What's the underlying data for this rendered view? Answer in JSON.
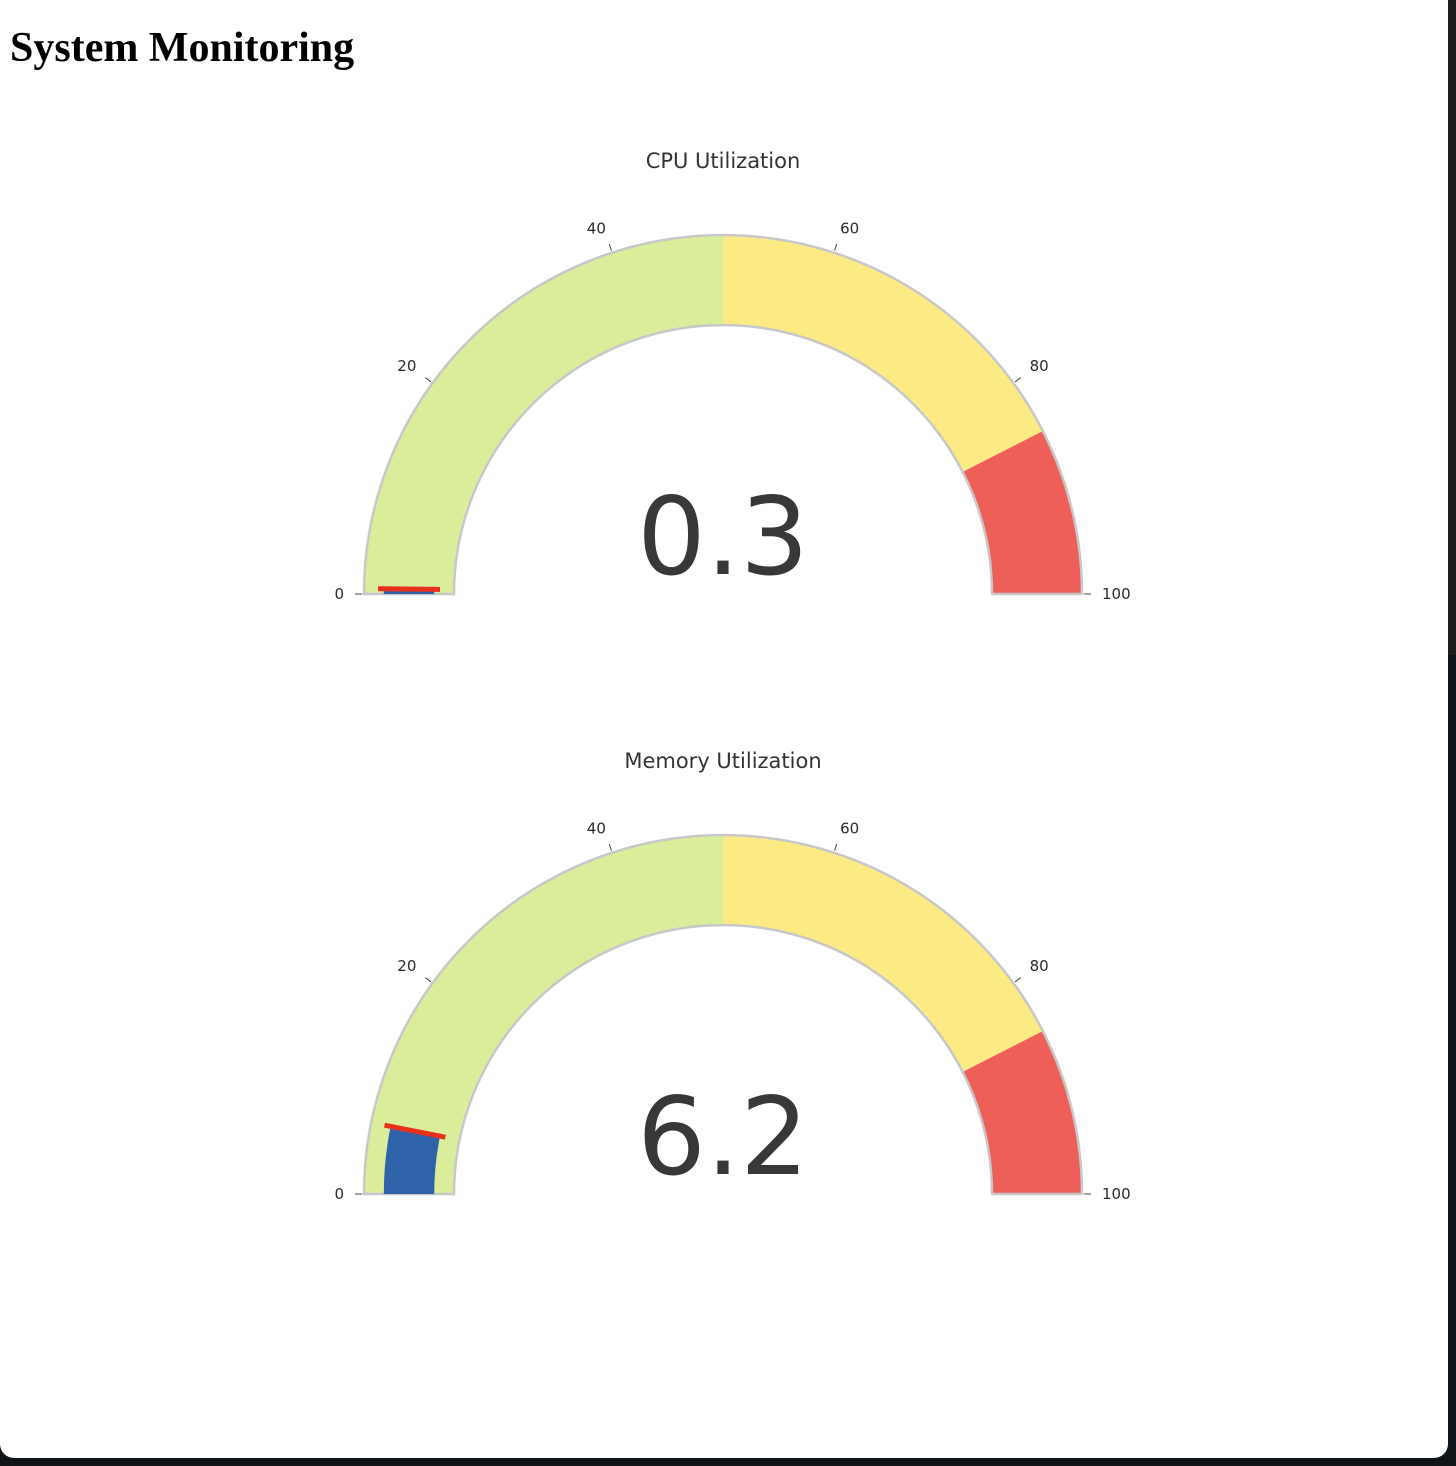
{
  "page": {
    "title": "System Monitoring"
  },
  "chart_data": [
    {
      "type": "gauge",
      "title": "CPU Utilization",
      "value": 0.3,
      "value_label": "0.3",
      "range": [
        0,
        100
      ],
      "tick_values": [
        0,
        20,
        40,
        60,
        80,
        100
      ],
      "tick_labels": [
        "0",
        "20",
        "40",
        "60",
        "80",
        "100"
      ],
      "steps": [
        {
          "range": [
            0,
            50
          ],
          "color": "#d9ed9b"
        },
        {
          "range": [
            50,
            85
          ],
          "color": "#fceb85"
        },
        {
          "range": [
            85,
            100
          ],
          "color": "#ef5f5a"
        }
      ],
      "bar_color": "#2f63a9",
      "threshold": {
        "value": 0.3,
        "color": "#e8301c"
      }
    },
    {
      "type": "gauge",
      "title": "Memory Utilization",
      "value": 6.2,
      "value_label": "6.2",
      "range": [
        0,
        100
      ],
      "tick_values": [
        0,
        20,
        40,
        60,
        80,
        100
      ],
      "tick_labels": [
        "0",
        "20",
        "40",
        "60",
        "80",
        "100"
      ],
      "steps": [
        {
          "range": [
            0,
            50
          ],
          "color": "#d9ed9b"
        },
        {
          "range": [
            50,
            85
          ],
          "color": "#fceb85"
        },
        {
          "range": [
            85,
            100
          ],
          "color": "#ef5f5a"
        }
      ],
      "bar_color": "#2f63a9",
      "threshold": {
        "value": 6.2,
        "color": "#e8301c"
      }
    }
  ]
}
